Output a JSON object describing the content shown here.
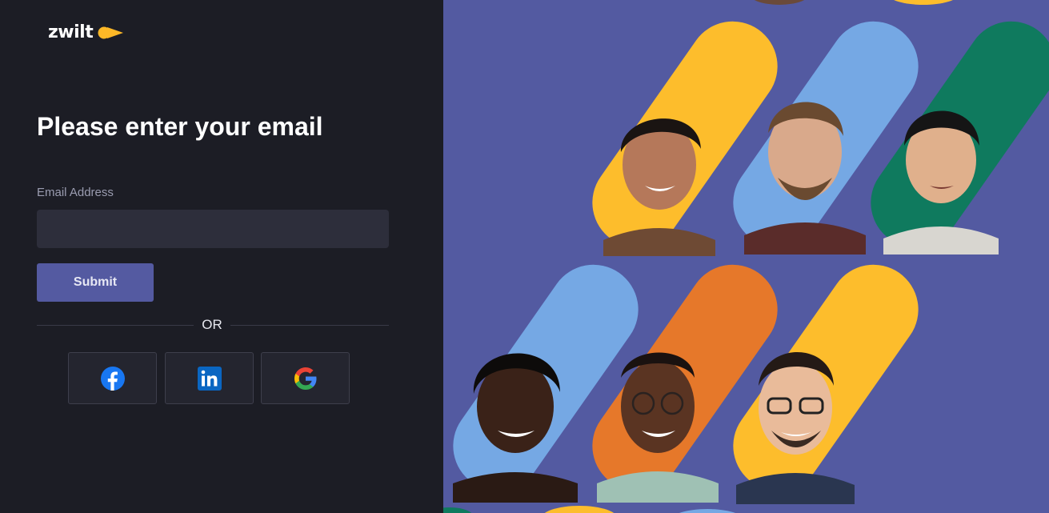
{
  "brand": {
    "name": "zwilt",
    "logo_icon": "arrow-dot-logo",
    "accent_color": "#fdb827"
  },
  "form": {
    "title": "Please enter your email",
    "email_label": "Email Address",
    "email_value": "",
    "email_placeholder": "",
    "submit_label": "Submit",
    "divider_text": "OR"
  },
  "social": [
    {
      "name": "facebook",
      "icon": "facebook-icon",
      "color": "#1877f2"
    },
    {
      "name": "linkedin",
      "icon": "linkedin-icon",
      "color": "#0a66c2"
    },
    {
      "name": "google",
      "icon": "google-icon",
      "color": "#4285f4"
    }
  ],
  "colors": {
    "left_background": "#1c1d25",
    "input_background": "#2d2e3b",
    "submit_background": "#545aa1",
    "hero_background": "#535aa1",
    "pill_yellow": "#fdbd2c",
    "pill_blue": "#75a8e4",
    "pill_green": "#0f7a5e",
    "pill_orange": "#e6782a"
  }
}
